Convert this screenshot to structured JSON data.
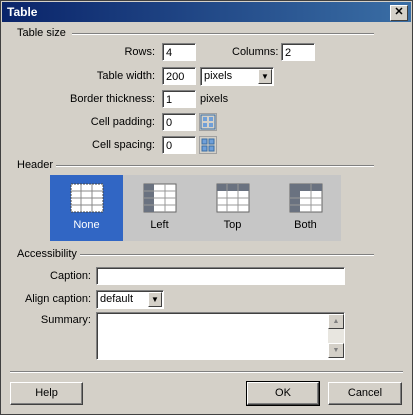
{
  "window": {
    "title": "Table",
    "close_glyph": "✕"
  },
  "table_size": {
    "section_label": "Table size",
    "rows_label": "Rows:",
    "rows_value": "4",
    "columns_label": "Columns:",
    "columns_value": "2",
    "width_label": "Table width:",
    "width_value": "200",
    "width_unit": "pixels",
    "border_label": "Border thickness:",
    "border_value": "1",
    "border_unit": "pixels",
    "padding_label": "Cell padding:",
    "padding_value": "0",
    "spacing_label": "Cell spacing:",
    "spacing_value": "0"
  },
  "header": {
    "section_label": "Header",
    "options": [
      {
        "label": "None",
        "selected": true
      },
      {
        "label": "Left",
        "selected": false
      },
      {
        "label": "Top",
        "selected": false
      },
      {
        "label": "Both",
        "selected": false
      }
    ]
  },
  "accessibility": {
    "section_label": "Accessibility",
    "caption_label": "Caption:",
    "caption_value": "",
    "align_label": "Align caption:",
    "align_value": "default",
    "summary_label": "Summary:",
    "summary_value": ""
  },
  "buttons": {
    "help": "Help",
    "ok": "OK",
    "cancel": "Cancel"
  },
  "colors": {
    "selected_option": "#3166c4",
    "titlebar": "#0a246a"
  },
  "icons": [
    "close-icon",
    "cell-padding-icon",
    "cell-spacing-icon",
    "dropdown-arrow-icon",
    "scroll-up-icon",
    "scroll-down-icon"
  ]
}
